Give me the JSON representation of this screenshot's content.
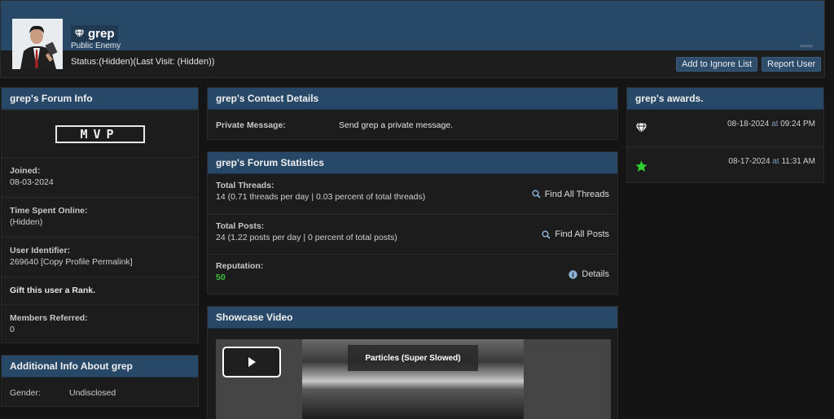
{
  "header": {
    "username": "grep",
    "user_title": "Public Enemy",
    "status": "Status:(Hidden)(Last Visit: (Hidden))",
    "ignore_button": "Add to Ignore List",
    "report_button": "Report User"
  },
  "forum_info": {
    "title": "grep's Forum Info",
    "badge": "MVP",
    "joined_label": "Joined:",
    "joined_value": "08-03-2024",
    "time_online_label": "Time Spent Online:",
    "time_online_value": "(Hidden)",
    "identifier_label": "User Identifier:",
    "identifier_value": "269640",
    "permalink_open": "[",
    "permalink_text": "Copy Profile Permalink",
    "permalink_close": "]",
    "gift_text": "Gift this user a Rank.",
    "referred_label": "Members Referred:",
    "referred_value": "0"
  },
  "additional_info": {
    "title": "Additional Info About grep",
    "gender_label": "Gender:",
    "gender_value": "Undisclosed"
  },
  "contact": {
    "title": "grep's Contact Details",
    "pm_label": "Private Message:",
    "pm_link": "Send grep a private message."
  },
  "statistics": {
    "title": "grep's Forum Statistics",
    "threads_label": "Total Threads:",
    "threads_value": "14 (0.71 threads per day | 0.03 percent of total threads)",
    "threads_link": "Find All Threads",
    "posts_label": "Total Posts:",
    "posts_value": "24 (1.22 posts per day | 0 percent of total posts)",
    "posts_link": "Find All Posts",
    "reputation_label": "Reputation:",
    "reputation_value": "50",
    "details_link": "Details"
  },
  "showcase": {
    "title": "Showcase Video",
    "video_title": "Particles (Super Slowed)"
  },
  "awards": {
    "title": "grep's awards.",
    "at_word": "at",
    "items": [
      {
        "icon": "diamond-icon",
        "date": "08-18-2024",
        "time": "09:24 PM"
      },
      {
        "icon": "star-icon",
        "date": "08-17-2024",
        "time": "11:31 AM"
      }
    ]
  },
  "colors": {
    "header_blue": "#274867",
    "panel_bg": "#1c1c1c",
    "page_bg": "#141414",
    "reputation_green": "#3fc13f",
    "star_green": "#2fd02f"
  }
}
